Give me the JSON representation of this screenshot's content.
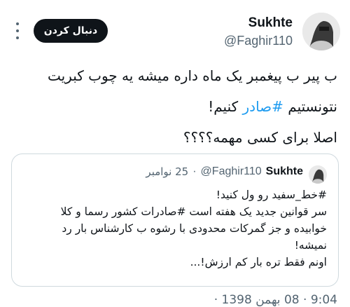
{
  "author": {
    "name": "Sukhte",
    "handle": "@Faghir110",
    "follow_label": "دنبال کردن"
  },
  "tweet": {
    "line1": "ب پیر ب پیغمبر یک ماه داره میشه یه چوب کبریت",
    "line2_prefix": "نتونستیم ",
    "line2_hashtag": "#صادر",
    "line2_suffix": " کنیم!",
    "line3": "اصلا برای کسی مهمه؟؟؟؟"
  },
  "quoted_tweet": {
    "name": "Sukhte",
    "handle": "@Faghir110",
    "separator": "·",
    "date": "25 نوامبر",
    "line1": "#خط_سفید رو ول کنید!",
    "line2": "سر قوانین جدید یک هفته است #صادرات کشور رسما و کلا",
    "line3": "خوابیده و جز گمرکات محدودی با رشوه ب کارشناس بار رد",
    "line4": "نمیشه!",
    "line5": "اونم فقط تره بار کم ارزش!..."
  },
  "footer": {
    "timestamp": "9:04 · 08 بهمن 1398 ·"
  },
  "icons": {
    "more": "more-dots-icon",
    "avatar": "avatar"
  },
  "colors": {
    "link": "#1d9bf0",
    "text": "#0f1419",
    "secondary": "#536471",
    "button_bg": "#0f1419"
  }
}
